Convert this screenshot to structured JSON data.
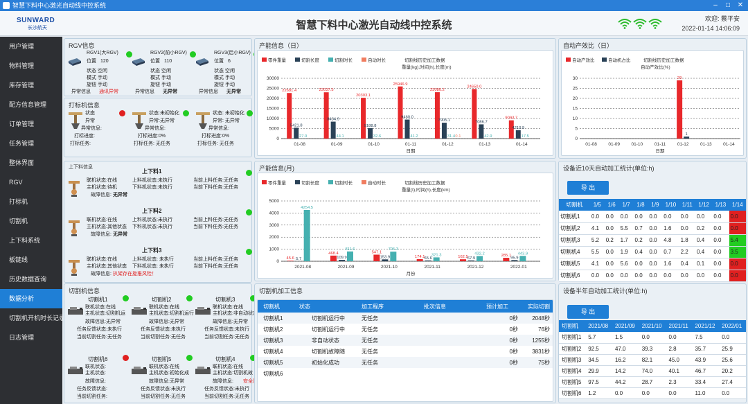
{
  "window_title": "智慧下料中心激光自动线中控系统",
  "header": {
    "logo_en": "SUNWARD",
    "logo_cn": "长沙航天",
    "title": "智慧下料中心激光自动线中控系统",
    "welcome": "欢迎: 蔡平安",
    "datetime": "2022-01-14 14:06:09"
  },
  "sidebar": {
    "items": [
      "用户管理",
      "物料管理",
      "库存管理",
      "配方信息管理",
      "订单管理",
      "任务管理",
      "整体界面",
      "RGV",
      "打标机",
      "切割机",
      "上下料系统",
      "板链线",
      "历史数据查询",
      "数据分析",
      "切割机开机时长记录",
      "日志管理"
    ],
    "active": 13
  },
  "rgv": {
    "title": "RGV信息",
    "units": [
      {
        "name": "RGV1(大RGV)",
        "pos_label": "位置",
        "pos": "120",
        "l1": "状态  空闲",
        "l2": "模式  手动",
        "l3": "旋钮  手动",
        "err_label": "异常信息",
        "err": "通讯异常"
      },
      {
        "name": "RGV2(前小RGV)",
        "pos_label": "位置",
        "pos": "110",
        "l1": "状态  空闲",
        "l2": "模式  手动",
        "l3": "旋钮  手动",
        "err_label": "异常信息",
        "err": "无异常"
      },
      {
        "name": "RGV3(后小RGV)",
        "pos_label": "位置",
        "pos": "6",
        "l1": "状态  空闲",
        "l2": "模式  手动",
        "l3": "旋钮  手动",
        "err_label": "异常信息",
        "err": "无异常"
      }
    ]
  },
  "marker": {
    "title": "打标机信息",
    "units": [
      {
        "l1": "状态",
        "l2": "异常",
        "l3": "异常信息:",
        "l4": "打标进度:",
        "l5": "打标任务:"
      },
      {
        "l1": "状态:未初始化",
        "l2": "异常:无异常",
        "l3": "异常信息:",
        "l4": "打标进度:0%",
        "l5": "打标任务: 无任务"
      },
      {
        "l1": "状态: 未初始化",
        "l2": "异常: 无异常",
        "l3": "异常信息:",
        "l4": "打标进度:0%",
        "l5": "打标任务: 无任务"
      }
    ]
  },
  "loader": {
    "title": "上下料信息",
    "units": [
      {
        "name": "上下料1",
        "a1": "联机状态:在线",
        "a2": "主机状态:待机",
        "a3": "故障信息:",
        "a3v": "无异常",
        "b1": "上料机状态:未执行",
        "b2": "下料机状态:未执行",
        "c1": "当前上料任务:无任务",
        "c2": "当前下料任务:无任务",
        "warn": false
      },
      {
        "name": "上下料2",
        "a1": "联机状态:在线",
        "a2": "主机状态:其他状态",
        "a3": "故障信息:",
        "a3v": "无异常",
        "b1": "上料机状态:未执行",
        "b2": "下料机状态:未执行",
        "c1": "当前上料任务:无任务",
        "c2": "当前下料任务:无任务",
        "warn": false
      },
      {
        "name": "上下料3",
        "a1": "联机状态:在线",
        "a2": "主机状态:其他状态",
        "a3": "故障信息:",
        "a3v": "扒架存在旋推风险！",
        "b1": "上料机状态: 未执行",
        "b2": "下料机状态: 未执行",
        "c1": "当前上料任务:无任务",
        "c2": "当前下料任务:无任务",
        "warn": true
      }
    ]
  },
  "cutters": {
    "title": "切割机信息",
    "units": [
      {
        "name": "切割机1",
        "l1": "联机状态:在线",
        "l2": "主机状态:切割机运",
        "l3": "故障信息:无异常",
        "l4": "任务反馈状态:未执行",
        "l5": "当前切割任务:无任务",
        "red": false
      },
      {
        "name": "切割机2",
        "l1": "联机状态:在线",
        "l2": "主机状态:切割机运行",
        "l3": "故障信息:无异常",
        "l4": "任务反馈状态:未执行",
        "l5": "当前切割任务:无任务",
        "red": false
      },
      {
        "name": "切割机3",
        "l1": "联机状态:在线",
        "l2": "主机状态:非自动状态",
        "l3": "故障信息:无异常",
        "l4": "任务反馈状态:未执行",
        "l5": "当前切割任务:无任务",
        "red": false
      },
      {
        "name": "切割机6",
        "l1": "联机状态:",
        "l2": "主机状态:",
        "l3": "故障信息:",
        "l4": "任务反馈状态:",
        "l5": "当前切割任务:",
        "red": false
      },
      {
        "name": "切割机5",
        "l1": "联机状态:在线",
        "l2": "主机状态:初始化成",
        "l3": "故障信息:无异常",
        "l4": "任务反馈状态:未执行",
        "l5": "当前切割任务:无任务",
        "red": false
      },
      {
        "name": "切割机4",
        "l1": "联机状态:在线",
        "l2": "主机状态:切割机故",
        "l3": "故障信息:",
        "l3v": "安全门未",
        "l4": "任务反馈状态:未执行",
        "l5": "当前切割任务:无任务",
        "red": true
      }
    ]
  },
  "dot_colors": {
    "rgv": [
      "green",
      "green",
      "green"
    ],
    "marker": [
      "red",
      "green",
      "green"
    ],
    "loader": [
      "green",
      "green",
      "green"
    ],
    "cutters": [
      "green",
      "green",
      "green",
      "red",
      "green",
      "green"
    ]
  },
  "chart_day": {
    "title": "产能信息（日）"
  },
  "chart_month": {
    "title": "产能信息(月)"
  },
  "chart_auto": {
    "title": "自动产效比（日）"
  },
  "chart_data": [
    {
      "type": "bar",
      "title": "切割线历史加工数据",
      "subtitle": "重量(kg),时间(h),长度(m)",
      "xlabel": "日期",
      "categories": [
        "01-08",
        "01-09",
        "01-10",
        "01-11",
        "01-12",
        "01-13",
        "01-14"
      ],
      "ylim": [
        0,
        30000
      ],
      "yticks": [
        0,
        5000,
        10000,
        15000,
        20000,
        25000,
        30000
      ],
      "series": [
        {
          "name": "零件重量",
          "color": "#e8282b",
          "values": [
            22681.4,
            23037.5,
            20303.1,
            25946.9,
            23080.2,
            24650.0,
            9093.7
          ],
          "labels": [
            "22681.4",
            "23037.5",
            "20303.1",
            "25946.9",
            "23080.2",
            "24650.0",
            "9093.7"
          ]
        },
        {
          "name": "切割长度",
          "color": "#2a4257",
          "values": [
            5421.8,
            8434.9,
            5188.8,
            9460.0,
            7905.1,
            7086.7,
            4210.9
          ],
          "labels": [
            "5421.8",
            "8434.9",
            "5188.8",
            "9460.0",
            "7905.1",
            "7086.7",
            "4210.9"
          ]
        },
        {
          "name": "切割时长",
          "color": "#45b0b0",
          "values": [
            27.9,
            44.1,
            32.6,
            41.2,
            31.4,
            42.9,
            17.5
          ],
          "labels": [
            "27.9",
            "44.1",
            "32.6",
            "41.2",
            "31.4",
            "42.9",
            "17.5"
          ]
        },
        {
          "name": "自动时长",
          "color": "#f07d60",
          "values": [
            0,
            0,
            0,
            0,
            0.1,
            0,
            0
          ],
          "labels": [
            "",
            "",
            "",
            "",
            "0.1",
            "",
            ""
          ]
        }
      ]
    },
    {
      "type": "bar",
      "title": "切割线历史加工数据",
      "subtitle": "重量(t),时间(h),长度(km)",
      "xlabel": "月份",
      "categories": [
        "2021-08",
        "2021-09",
        "2021-10",
        "2021-11",
        "2021-12",
        "2022-01"
      ],
      "ylim": [
        0,
        5000
      ],
      "yticks": [
        0,
        1000,
        2000,
        3000,
        4000,
        5000
      ],
      "series": [
        {
          "name": "零件重量",
          "color": "#e8282b",
          "values": [
            45.6,
            468.4,
            547.1,
            174.1,
            162.5,
            285.1
          ],
          "labels": [
            "45.6",
            "468.4",
            "547.1",
            "174.1",
            "162.5",
            "285.1"
          ]
        },
        {
          "name": "切割长度",
          "color": "#2a4257",
          "values": [
            5.7,
            109.9,
            153.9,
            65.6,
            67.9,
            95.9
          ],
          "labels": [
            "5.7",
            "109.9",
            "153.9",
            "65.6",
            "67.9",
            "95.9"
          ]
        },
        {
          "name": "切割时长",
          "color": "#45b0b0",
          "values": [
            4254.5,
            811.6,
            795.3,
            321.3,
            432.2,
            443.9
          ],
          "labels": [
            "4254.5",
            "811.6",
            "795.3",
            "321.3",
            "432.2",
            "443.9"
          ]
        },
        {
          "name": "自动时长",
          "color": "#f07d60",
          "values": [
            0,
            0,
            0,
            0,
            0,
            0
          ],
          "labels": [
            "",
            "",
            "",
            "",
            "",
            ""
          ]
        }
      ]
    },
    {
      "type": "bar",
      "title": "切割线历史加工数据",
      "subtitle": "自动产效比(%)",
      "xlabel": "日期",
      "categories": [
        "01-08",
        "01-09",
        "01-10",
        "01-11",
        "01-12",
        "01-13",
        "01-14"
      ],
      "ylim": [
        0,
        30
      ],
      "yticks": [
        0,
        5,
        10,
        15,
        20,
        25,
        30
      ],
      "series": [
        {
          "name": "自动产效比",
          "color": "#e8282b",
          "values": [
            0,
            0,
            0,
            0,
            29,
            0,
            0
          ],
          "labels": [
            "",
            "",
            "",
            "",
            "29",
            "",
            ""
          ]
        },
        {
          "name": "自动机占比",
          "color": "#2a4257",
          "values": [
            0,
            0,
            0,
            0,
            1,
            0,
            0
          ],
          "labels": [
            "",
            "",
            "",
            "",
            "1",
            "",
            ""
          ]
        }
      ]
    }
  ],
  "process": {
    "title": "切割机加工信息",
    "headers": [
      "切割机",
      "状态",
      "加工程序",
      "批次信息",
      "预计加工",
      "实际切割"
    ],
    "rows": [
      [
        "切割机1",
        "切割机运行中",
        "无任务",
        "",
        "0秒",
        "2048秒"
      ],
      [
        "切割机2",
        "切割机运行中",
        "无任务",
        "",
        "0秒",
        "76秒"
      ],
      [
        "切割机3",
        "非自动状态",
        "无任务",
        "",
        "0秒",
        "1255秒"
      ],
      [
        "切割机4",
        "切割机故障随",
        "无任务",
        "",
        "0秒",
        "3831秒"
      ],
      [
        "切割机5",
        "初始化成功",
        "无任务",
        "",
        "0秒",
        "75秒"
      ],
      [
        "切割机6",
        "",
        "",
        "",
        "",
        ""
      ]
    ]
  },
  "auto10": {
    "title": "设备近10天自动加工统计(单位:h)",
    "export": "导 出",
    "headers": [
      "切割机",
      "1/5",
      "1/6",
      "1/7",
      "1/8",
      "1/9",
      "1/10",
      "1/11",
      "1/12",
      "1/13",
      "1/14"
    ],
    "rows": [
      [
        "切割机1",
        "0.0",
        "0.0",
        "0.0",
        "0.0",
        "0.0",
        "0.0",
        "0.0",
        "0.0",
        "0.0",
        "0.0"
      ],
      [
        "切割机2",
        "4.1",
        "0.0",
        "5.5",
        "0.7",
        "0.0",
        "1.6",
        "0.0",
        "0.2",
        "0.0",
        "0.0"
      ],
      [
        "切割机3",
        "5.2",
        "0.2",
        "1.7",
        "0.2",
        "0.0",
        "4.8",
        "1.8",
        "0.4",
        "0.0",
        "5.4"
      ],
      [
        "切割机4",
        "5.5",
        "0.0",
        "1.9",
        "0.4",
        "0.0",
        "0.7",
        "2.2",
        "0.4",
        "0.0",
        "3.5"
      ],
      [
        "切割机5",
        "4.1",
        "0.0",
        "5.6",
        "0.0",
        "0.0",
        "1.6",
        "0.4",
        "0.1",
        "0.0",
        "0.0"
      ],
      [
        "切割机6",
        "0.0",
        "0.0",
        "0.0",
        "0.0",
        "0.0",
        "0.0",
        "0.0",
        "0.0",
        "0.0",
        "0.0"
      ]
    ],
    "last_col_status": [
      "red",
      "red",
      "green",
      "green",
      "red",
      "red"
    ]
  },
  "auto6": {
    "title": "设备半年自动加工统计(单位:h)",
    "export": "导 出",
    "headers": [
      "切割机",
      "2021/08",
      "2021/09",
      "2021/10",
      "2021/11",
      "2021/12",
      "2022/01"
    ],
    "rows": [
      [
        "切割机1",
        "5.7",
        "1.5",
        "0.0",
        "0.0",
        "7.5",
        "0.0"
      ],
      [
        "切割机2",
        "92.5",
        "47.0",
        "39.3",
        "2.8",
        "35.7",
        "25.9"
      ],
      [
        "切割机3",
        "34.5",
        "16.2",
        "82.1",
        "45.0",
        "43.9",
        "25.6"
      ],
      [
        "切割机4",
        "29.9",
        "14.2",
        "74.0",
        "40.1",
        "46.7",
        "20.2"
      ],
      [
        "切割机5",
        "97.5",
        "44.2",
        "28.7",
        "2.3",
        "33.4",
        "27.4"
      ],
      [
        "切割机6",
        "1.2",
        "0.0",
        "0.0",
        "0.0",
        "11.0",
        "0.0"
      ]
    ]
  }
}
